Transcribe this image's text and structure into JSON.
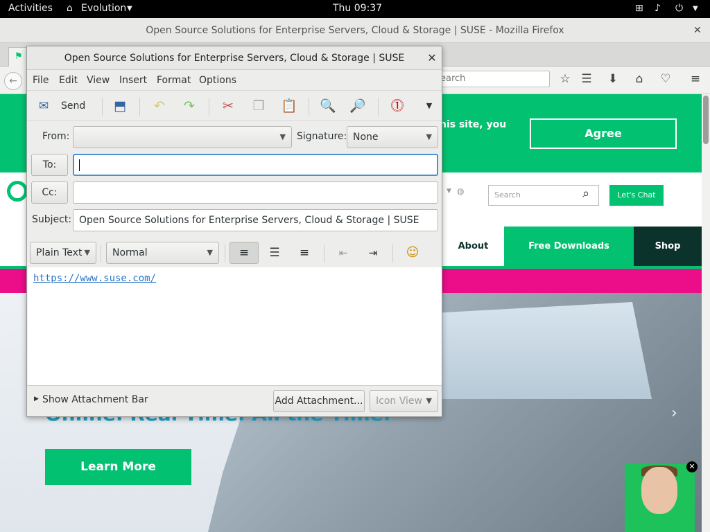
{
  "topbar": {
    "activities": "Activities",
    "app_name": "Evolution",
    "clock": "Thu 09:37"
  },
  "firefox": {
    "window_title": "Open Source Solutions for Enterprise Servers, Cloud & Storage | SUSE - Mozilla Firefox",
    "search_placeholder": "earch"
  },
  "webpage": {
    "cookie_text_fragment": "his site, you",
    "agree_label": "Agree",
    "site_search_placeholder": "Search",
    "chat_label": "Let's Chat",
    "nav": {
      "about": "About",
      "downloads": "Free Downloads",
      "shop": "Shop"
    },
    "hero_headline": "Online. Real Time. All the Time.",
    "learn_more": "Learn More"
  },
  "composer": {
    "title": "Open Source Solutions for Enterprise Servers, Cloud & Storage | SUSE",
    "menu": [
      "File",
      "Edit",
      "View",
      "Insert",
      "Format",
      "Options"
    ],
    "toolbar": {
      "send_label": "Send"
    },
    "from_label": "From:",
    "from_value": "",
    "signature_label": "Signature:",
    "signature_value": "None",
    "to_button": "To:",
    "to_value": "",
    "cc_button": "Cc:",
    "cc_value": "",
    "subject_label": "Subject:",
    "subject_value": "Open Source Solutions for Enterprise Servers, Cloud & Storage | SUSE",
    "format_mode": "Plain Text",
    "paragraph_style": "Normal",
    "body_link": "https://www.suse.com/",
    "show_attachment_bar": "Show Attachment Bar",
    "add_attachment": "Add Attachment...",
    "view_mode": "Icon View"
  },
  "colors": {
    "suse_green": "#02c271",
    "suse_pink": "#ec0d89",
    "suse_dark": "#0c322c",
    "link_blue": "#2a76c6"
  }
}
